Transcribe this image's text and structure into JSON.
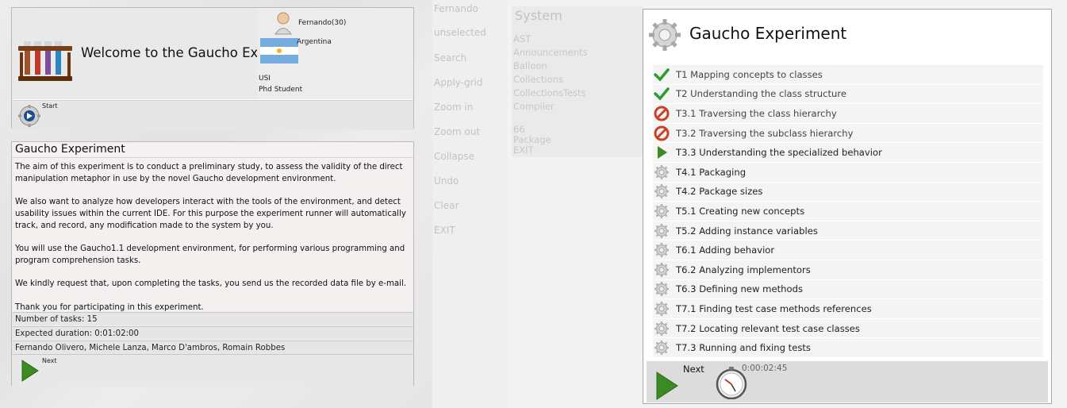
{
  "welcome": {
    "title": "Welcome to the Gaucho Experiment",
    "user_name": "Fernando(30)",
    "country": "Argentina",
    "institution": "USI",
    "role": "Phd Student",
    "start_label": "Start"
  },
  "info": {
    "title": "Gaucho Experiment",
    "paragraphs": [
      "The aim of this experiment is to conduct a preliminary study, to assess the validity of the direct manipulation metaphor in use by the novel Gaucho development environment.",
      "We also want to analyze how developers interact with the tools of the environment, and detect usability issues within the current IDE. For this purpose the experiment runner will automatically track, and record, any modification made to the system by you.",
      "You will use the Gaucho1.1 development environment, for performing various programming and program comprehension tasks.",
      "We kindly request that, upon completing the tasks, you send us the recorded data file by e-mail.",
      "Thank you for participating in this experiment."
    ],
    "num_tasks": "Number of tasks: 15",
    "duration": "Expected duration: 0:01:02:00",
    "authors": "Fernando Olivero, Michele Lanza, Marco D'ambros, Romain Robbes",
    "next_label": "Next"
  },
  "background_app": {
    "sidebar": [
      "Fernando",
      "unselected",
      "Search",
      "Apply-grid",
      "Zoom in",
      "Zoom out",
      "Collapse",
      "Undo",
      "Clear",
      "EXIT"
    ],
    "system_title": "System",
    "system_items": [
      "AST",
      "Announcements",
      "Balloon",
      "Collections",
      "CollectionsTests",
      "Compiler"
    ],
    "bottom_items": [
      "66",
      "Package",
      "EXIT"
    ]
  },
  "tasks_window": {
    "title": "Gaucho Experiment",
    "tasks": [
      {
        "label": "T1  Mapping concepts to classes",
        "status": "done"
      },
      {
        "label": "T2  Understanding the class structure",
        "status": "done"
      },
      {
        "label": "T3.1  Traversing the class hierarchy",
        "status": "failed"
      },
      {
        "label": "T3.2  Traversing the subclass hierarchy",
        "status": "failed"
      },
      {
        "label": "T3.3  Understanding the specialized behavior",
        "status": "current"
      },
      {
        "label": "T4.1  Packaging",
        "status": "pending"
      },
      {
        "label": "T4.2  Package sizes",
        "status": "pending"
      },
      {
        "label": "T5.1  Creating new concepts",
        "status": "pending"
      },
      {
        "label": "T5.2  Adding instance variables",
        "status": "pending"
      },
      {
        "label": "T6.1  Adding behavior",
        "status": "pending"
      },
      {
        "label": "T6.2  Analyzing implementors",
        "status": "pending"
      },
      {
        "label": "T6.3  Defining new methods",
        "status": "pending"
      },
      {
        "label": "T7.1  Finding test case methods references",
        "status": "pending"
      },
      {
        "label": "T7.2  Locating relevant test case classes",
        "status": "pending"
      },
      {
        "label": "T7.3  Running and fixing tests",
        "status": "pending"
      }
    ],
    "next_label": "Next",
    "timer": "0:00:02:45"
  },
  "colors": {
    "check": "#2f9a2f",
    "stop": "#c9402b",
    "play": "#3c8a24"
  }
}
